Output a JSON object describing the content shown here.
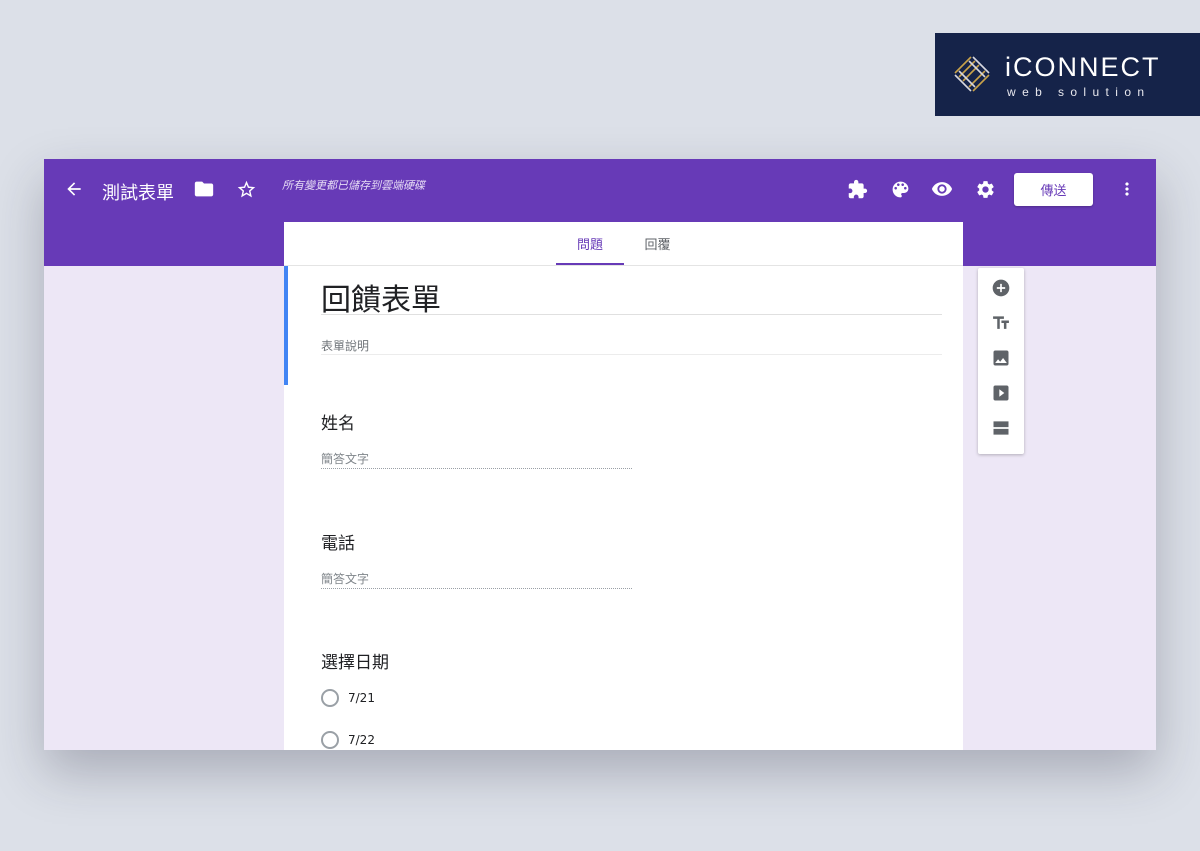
{
  "logo": {
    "brand": "iCONNECT",
    "tagline": "web solution"
  },
  "header": {
    "form_title": "測試表單",
    "saved_note": "所有變更都已儲存到雲端硬碟",
    "send_label": "傳送"
  },
  "tabs": [
    {
      "label": "問題",
      "active": true
    },
    {
      "label": "回覆",
      "active": false
    }
  ],
  "form": {
    "title": "回饋表單",
    "description_placeholder": "表單說明"
  },
  "questions": [
    {
      "title": "姓名",
      "type": "short_answer",
      "placeholder": "簡答文字"
    },
    {
      "title": "電話",
      "type": "short_answer",
      "placeholder": "簡答文字"
    },
    {
      "title": "選擇日期",
      "type": "multiple_choice",
      "options": [
        "7/21",
        "7/22"
      ]
    }
  ],
  "colors": {
    "theme": "#673ab7",
    "background": "#ede7f6",
    "active_section": "#4285f4",
    "logo_background": "#152349"
  },
  "icons": {
    "header": [
      "arrow-back-icon",
      "folder-icon",
      "star-icon",
      "puzzle-icon",
      "palette-icon",
      "eye-icon",
      "gear-icon",
      "more-vert-icon"
    ],
    "side_toolbar": [
      "add-circle-icon",
      "title-text-icon",
      "image-icon",
      "video-icon",
      "section-icon"
    ]
  }
}
